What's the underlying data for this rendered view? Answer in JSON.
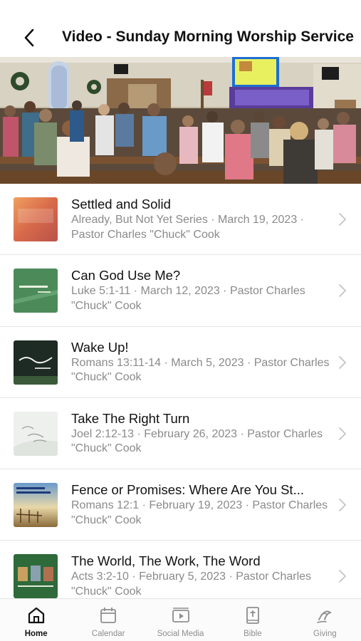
{
  "header": {
    "title": "Video - Sunday Morning Worship Service",
    "back_icon": "chevron-left-icon"
  },
  "sermons": [
    {
      "title": "Settled and Solid",
      "subtitle": "Already, But Not Yet Series · March 19, 2023 · Pastor Charles \"Chuck\" Cook",
      "thumb_text": "Settled and Solid"
    },
    {
      "title": "Can God Use Me?",
      "subtitle": "Luke 5:1-11 · March 12, 2023 · Pastor Charles \"Chuck\" Cook",
      "thumb_text": "Can God Use Me?"
    },
    {
      "title": "Wake Up!",
      "subtitle": "Romans 13:11-14 · March 5, 2023 · Pastor Charles \"Chuck\" Cook",
      "thumb_text": "Wake Up!"
    },
    {
      "title": "Take The Right Turn",
      "subtitle": "Joel 2:12-13 · February 26, 2023 · Pastor Charles \"Chuck\" Cook",
      "thumb_text": "Take The Right Turn"
    },
    {
      "title": "Fence or Promises: Where Are You St...",
      "subtitle": "Romans 12:1 · February 19, 2023 · Pastor Charles \"Chuck\" Cook",
      "thumb_text": "Fence or Promises: Where Are You Standing?"
    },
    {
      "title": "The World, The Work, The Word",
      "subtitle": "Acts 3:2-10 · February 5, 2023 · Pastor Charles \"Chuck\" Cook",
      "thumb_text": "THE WORLD, THE WORK, THE WORD"
    }
  ],
  "tabbar": {
    "tabs": [
      {
        "label": "Home",
        "icon": "home-icon",
        "active": true
      },
      {
        "label": "Calendar",
        "icon": "calendar-icon",
        "active": false
      },
      {
        "label": "Social Media",
        "icon": "video-play-icon",
        "active": false
      },
      {
        "label": "Bible",
        "icon": "bible-icon",
        "active": false
      },
      {
        "label": "Giving",
        "icon": "giving-icon",
        "active": false
      }
    ]
  },
  "colors": {
    "active_tab": "#111111",
    "inactive_tab": "#8e8e8e",
    "subtitle": "#8a8a8a",
    "divider": "#e6e6e6"
  }
}
